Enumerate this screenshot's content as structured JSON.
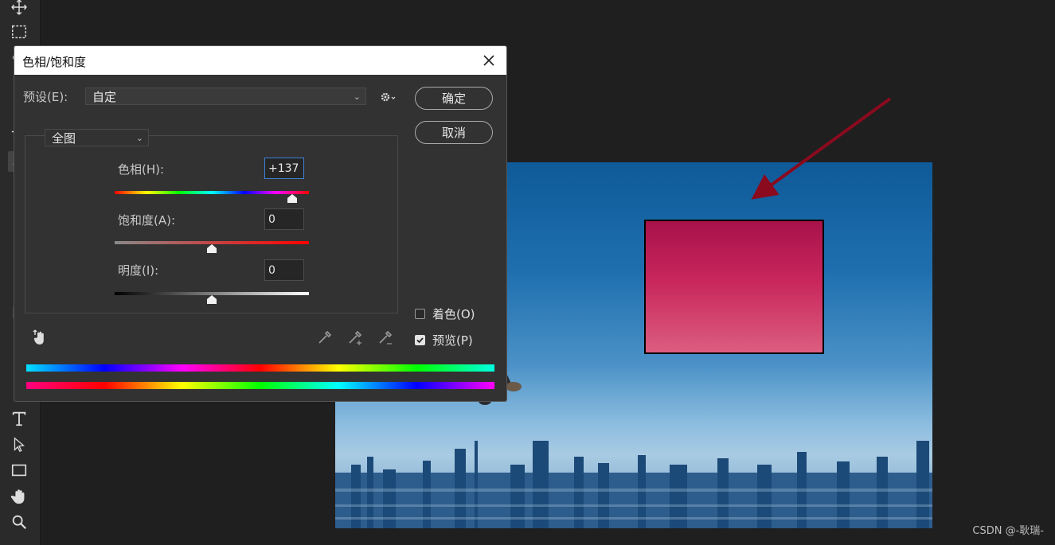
{
  "dialog": {
    "title": "色相/饱和度",
    "preset_label": "预设(E):",
    "preset_value": "自定",
    "ok_label": "确定",
    "cancel_label": "取消",
    "channel_value": "全图",
    "hue_label": "色相(H):",
    "hue_value": "+137",
    "saturation_label": "饱和度(A):",
    "saturation_value": "0",
    "lightness_label": "明度(I):",
    "lightness_value": "0",
    "colorize_label": "着色(O)",
    "colorize_checked": false,
    "preview_label": "预览(P)",
    "preview_checked": true
  },
  "toolbar": {
    "tools": [
      "move-icon",
      "marquee-icon",
      "lasso-icon",
      "crop-icon",
      "brush-icon",
      "eraser-icon",
      "text-icon",
      "path-select-icon",
      "rectangle-icon",
      "hand-icon",
      "zoom-icon"
    ]
  },
  "watermark": "CSDN @-耿瑞-",
  "colors": {
    "arrow": "#8b0a1e",
    "selection_top": "#a8124a",
    "selection_bottom": "#dc5d7f",
    "sky_top": "#0f5a98"
  }
}
